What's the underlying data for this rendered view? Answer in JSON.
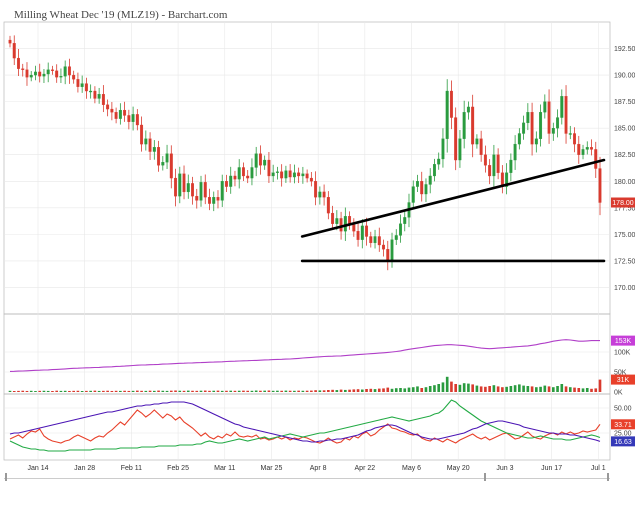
{
  "chart_data": {
    "type": "candlestick",
    "title": "Milling Wheat Dec '19 (MLZ19) - Barchart.com",
    "x_ticks": [
      "Jan 14",
      "Jan 28",
      "Feb 11",
      "Feb 25",
      "Mar 11",
      "Mar 25",
      "Apr 8",
      "Apr 22",
      "May 6",
      "May 20",
      "Jun 3",
      "Jun 17",
      "Jul 1"
    ],
    "price_axis": {
      "ylim": [
        167.5,
        195.0
      ],
      "ticks": [
        "192.50",
        "190.00",
        "187.50",
        "185.00",
        "182.50",
        "180.00",
        "177.50",
        "175.00",
        "172.50",
        "170.00"
      ],
      "last_price": "178.00",
      "last_price_value": 178.0
    },
    "price_series": [
      193.0,
      191.6,
      190.6,
      190.5,
      189.8,
      190.0,
      190.3,
      189.9,
      190.1,
      190.5,
      190.4,
      189.8,
      189.9,
      190.8,
      190.0,
      189.6,
      188.9,
      189.2,
      188.5,
      188.5,
      187.8,
      188.2,
      187.2,
      186.8,
      186.5,
      185.9,
      186.7,
      186.2,
      185.6,
      186.3,
      185.3,
      183.5,
      184.0,
      182.8,
      183.2,
      181.5,
      181.8,
      182.6,
      180.3,
      178.6,
      180.7,
      179.0,
      179.8,
      178.6,
      178.2,
      179.9,
      178.5,
      177.9,
      178.5,
      178.2,
      180.0,
      179.5,
      180.5,
      180.2,
      181.3,
      180.5,
      180.3,
      181.3,
      182.6,
      181.5,
      182.0,
      180.5,
      180.8,
      180.9,
      180.3,
      181.0,
      180.4,
      180.8,
      180.5,
      180.7,
      180.3,
      180.0,
      178.5,
      179.0,
      178.5,
      177.0,
      176.0,
      176.5,
      175.3,
      176.7,
      175.9,
      175.3,
      174.5,
      175.8,
      174.8,
      174.2,
      174.8,
      174.0,
      173.6,
      172.5,
      174.5,
      174.9,
      176.0,
      176.6,
      178.0,
      179.5,
      180.0,
      178.8,
      179.7,
      180.5,
      181.6,
      182.1,
      184.0,
      188.5,
      186.0,
      182.0,
      184.0,
      186.5,
      187.0,
      183.5,
      184.0,
      182.5,
      181.5,
      180.5,
      182.5,
      180.8,
      179.5,
      180.8,
      182.0,
      183.5,
      184.5,
      185.5,
      186.5,
      183.5,
      184.0,
      186.5,
      187.5,
      184.5,
      185.0,
      186.0,
      188.0,
      184.5,
      184.5,
      183.5,
      182.5,
      183.0,
      183.2,
      183.0,
      181.2,
      178.0
    ],
    "annotations": [
      {
        "type": "trendline",
        "from": [
          "Apr 8",
          174.8
        ],
        "to": [
          "Jul 8",
          182.0
        ]
      },
      {
        "type": "horizontal-line",
        "value": 172.5,
        "from": "Apr 8",
        "to": "Jul 8"
      }
    ],
    "volume_panel": {
      "ticks": [
        "153K",
        "100K",
        "50K",
        "0K"
      ],
      "ylim": [
        0,
        180000
      ],
      "open_interest_last": "153K",
      "open_interest_last_value": 153000,
      "volume_last": "31K",
      "volume_last_value": 31000,
      "open_interest": [
        68000,
        69000,
        70000,
        71000,
        72000,
        73000,
        75000,
        76000,
        77000,
        78000,
        80000,
        81000,
        82000,
        84000,
        86000,
        88000,
        89000,
        90000,
        91000,
        92000,
        93000,
        94000,
        96000,
        97000,
        98000,
        100000,
        101000,
        102000,
        104000,
        106000,
        108000,
        109000,
        110000,
        111000,
        112000,
        113000,
        115000,
        116000,
        117000,
        118000,
        120000,
        121000,
        122000,
        123000,
        124000,
        125000,
        126000,
        127000,
        128000,
        129000,
        130000,
        132000,
        133000,
        134000,
        135000,
        136000,
        137000,
        138000,
        139000,
        140000,
        142000,
        143000,
        144000,
        145000,
        146000,
        147000,
        148000,
        150000,
        152000,
        154000,
        156000,
        158000,
        160000,
        162000,
        164000,
        165000,
        166000,
        167000,
        168000,
        170000,
        172000,
        174000,
        176000,
        178000,
        180000,
        182000,
        184000,
        186000,
        188000,
        190000,
        193000,
        196000,
        200000,
        205000,
        210000,
        214000,
        218000,
        222000,
        226000,
        230000,
        234000,
        236000,
        238000,
        240000,
        240000,
        238000,
        236000,
        234000,
        230000,
        226000,
        222000,
        218000,
        216000,
        214000,
        216000,
        218000,
        220000,
        222000,
        224000,
        226000,
        228000,
        230000,
        232000,
        236000,
        240000,
        246000,
        250000,
        256000,
        262000,
        266000,
        270000,
        272000,
        270000,
        266000,
        262000,
        262000,
        264000,
        266000,
        266000,
        266000
      ],
      "volume": [
        3000,
        2500,
        2800,
        3200,
        2600,
        3000,
        2400,
        2900,
        3100,
        2700,
        2500,
        3300,
        2800,
        3000,
        2600,
        2900,
        3100,
        2500,
        2800,
        3000,
        3400,
        2700,
        2900,
        3200,
        2600,
        3000,
        2800,
        3100,
        2700,
        2900,
        3500,
        3000,
        2800,
        3300,
        2900,
        3600,
        3100,
        2800,
        3400,
        3800,
        3200,
        3000,
        3500,
        3100,
        2900,
        3300,
        3600,
        3000,
        3200,
        3500,
        2900,
        3100,
        3300,
        3000,
        3200,
        3400,
        3100,
        3000,
        3700,
        3200,
        3400,
        3800,
        3000,
        3300,
        3100,
        3500,
        3200,
        3000,
        3400,
        3100,
        3300,
        3600,
        4500,
        4000,
        4200,
        5000,
        5500,
        4800,
        6000,
        5200,
        5800,
        6500,
        7000,
        6200,
        7500,
        8000,
        7200,
        8500,
        9000,
        11000,
        8000,
        9500,
        10000,
        9000,
        11000,
        12000,
        14000,
        10000,
        12000,
        15000,
        17000,
        20000,
        24000,
        38000,
        26000,
        20000,
        18000,
        22000,
        21000,
        19000,
        16000,
        14000,
        13000,
        15000,
        17000,
        14000,
        12000,
        13000,
        15000,
        17000,
        19000,
        16000,
        15000,
        14000,
        12000,
        13000,
        16000,
        14000,
        12000,
        15000,
        20000,
        14000,
        12000,
        11000,
        10000,
        9000,
        10000,
        8000,
        9000,
        31000
      ]
    },
    "oscillator_panel": {
      "ticks": [
        "50.00",
        "25.00"
      ],
      "ylim": [
        0,
        62
      ],
      "value_labels": [
        "33.71",
        "16.63"
      ],
      "series": [
        {
          "color": "#e8402a",
          "last": 33.71,
          "values": [
            19,
            21,
            23,
            20,
            24,
            27,
            26,
            29,
            22,
            19,
            17,
            16,
            15,
            17,
            18,
            21,
            23,
            21,
            19,
            17,
            20,
            22,
            21,
            25,
            28,
            32,
            36,
            33,
            38,
            43,
            48,
            45,
            41,
            44,
            48,
            44,
            40,
            44,
            42,
            38,
            41,
            36,
            33,
            30,
            26,
            22,
            25,
            21,
            19,
            22,
            20,
            24,
            22,
            26,
            22,
            21,
            22,
            21,
            23,
            19,
            20,
            18,
            19,
            21,
            19,
            21,
            18,
            20,
            19,
            21,
            20,
            18,
            16,
            15,
            17,
            20,
            17,
            15,
            16,
            20,
            18,
            22,
            20,
            24,
            26,
            22,
            24,
            28,
            31,
            34,
            30,
            29,
            27,
            26,
            24,
            23,
            24,
            20,
            18,
            17,
            20,
            18,
            16,
            19,
            17,
            15,
            18,
            20,
            22,
            24,
            21,
            19,
            21,
            18,
            20,
            22,
            24,
            25,
            22,
            19,
            20,
            23,
            26,
            22,
            20,
            19,
            22,
            24,
            25,
            23,
            26,
            24,
            26,
            24,
            25,
            27,
            26,
            27,
            28,
            33.71
          ]
        },
        {
          "color": "#22aa44",
          "last": 20.5,
          "values": [
            17,
            15,
            13,
            11,
            10,
            9,
            9,
            8,
            8,
            7,
            7,
            7,
            7,
            7,
            8,
            8,
            8,
            8,
            8,
            8,
            9,
            9,
            9,
            9,
            9,
            9,
            10,
            10,
            10,
            10,
            10,
            11,
            11,
            11,
            11,
            12,
            12,
            12,
            12,
            12,
            13,
            13,
            13,
            13,
            14,
            14,
            16,
            17,
            16,
            15,
            15,
            16,
            17,
            18,
            19,
            18,
            17,
            18,
            19,
            20,
            21,
            19,
            20,
            21,
            22,
            23,
            24,
            23,
            22,
            21,
            22,
            23,
            24,
            25,
            25,
            26,
            27,
            28,
            29,
            30,
            31,
            32,
            33,
            34,
            35,
            36,
            37,
            38,
            39,
            40,
            41,
            40,
            39,
            38,
            37,
            38,
            39,
            40,
            41,
            42,
            44,
            45,
            48,
            53,
            58,
            56,
            52,
            49,
            46,
            43,
            40,
            37,
            35,
            33,
            31,
            29,
            27,
            25,
            24,
            23,
            22,
            21,
            20,
            20,
            21,
            22,
            21,
            20,
            19,
            19,
            19,
            18,
            18,
            19,
            20,
            21,
            22,
            23,
            22,
            20.5
          ]
        },
        {
          "color": "#4a14b4",
          "last": 16.63,
          "values": [
            24,
            25,
            25,
            26,
            27,
            28,
            29,
            30,
            31,
            32,
            33,
            34,
            35,
            36,
            37,
            38,
            39,
            40,
            41,
            42,
            43,
            44,
            45,
            46,
            46,
            47,
            48,
            49,
            50,
            51,
            52,
            52,
            53,
            53,
            54,
            54,
            55,
            55,
            56,
            56,
            56,
            56,
            55,
            54,
            52,
            50,
            48,
            46,
            44,
            42,
            40,
            38,
            36,
            34,
            33,
            31,
            30,
            29,
            28,
            27,
            26,
            25,
            24,
            23,
            22,
            21,
            20,
            19,
            18,
            17,
            17,
            16,
            16,
            17,
            17,
            18,
            18,
            19,
            19,
            20,
            21,
            22,
            23,
            25,
            27,
            28,
            30,
            31,
            32,
            33,
            33,
            32,
            30,
            28,
            26,
            24,
            23,
            21,
            20,
            19,
            19,
            19,
            20,
            21,
            22,
            23,
            24,
            25,
            27,
            29,
            30,
            32,
            34,
            35,
            36,
            37,
            37,
            36,
            35,
            34,
            33,
            31,
            30,
            29,
            28,
            27,
            26,
            25,
            25,
            24,
            24,
            24,
            23,
            23,
            22,
            21,
            20,
            19,
            18,
            16.63
          ]
        }
      ]
    },
    "colors": {
      "up": "#2a9b3f",
      "down": "#d93a2e",
      "open_interest": "#b03fc8",
      "oi_badge": "#c63fd8",
      "volume_badge": "#e8402a",
      "osc_badge_1": "#e8402a",
      "osc_badge_2": "#3438b8",
      "grid": "#e8e8e8",
      "axis": "#b8b8b8"
    }
  }
}
